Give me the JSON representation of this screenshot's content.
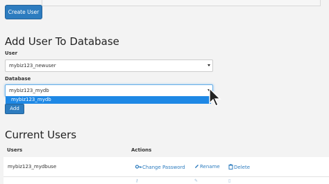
{
  "toolbar": {
    "create_user_label": "Create User"
  },
  "add_user_section": {
    "title": "Add User To Database",
    "user_label": "User",
    "user_value": "mybiz123_newuser",
    "database_label": "Database",
    "database_value": "mybiz123_mydb",
    "dropdown_options": [
      "mybiz123_mydb"
    ],
    "add_label": "Add"
  },
  "current_users": {
    "title": "Current Users",
    "columns": [
      "Users",
      "Actions"
    ],
    "rows": [
      {
        "user": "mybiz123_mydbuse",
        "actions": [
          "Change Password",
          "Rename",
          "Delete"
        ]
      }
    ]
  },
  "icons": [
    "key-icon",
    "pencil-icon",
    "trash-icon",
    "cursor-arrow-icon"
  ],
  "colors": {
    "accent": "#2d7cbf",
    "dropdown_highlight": "#1e88e5",
    "background": "#f3f3f3"
  }
}
